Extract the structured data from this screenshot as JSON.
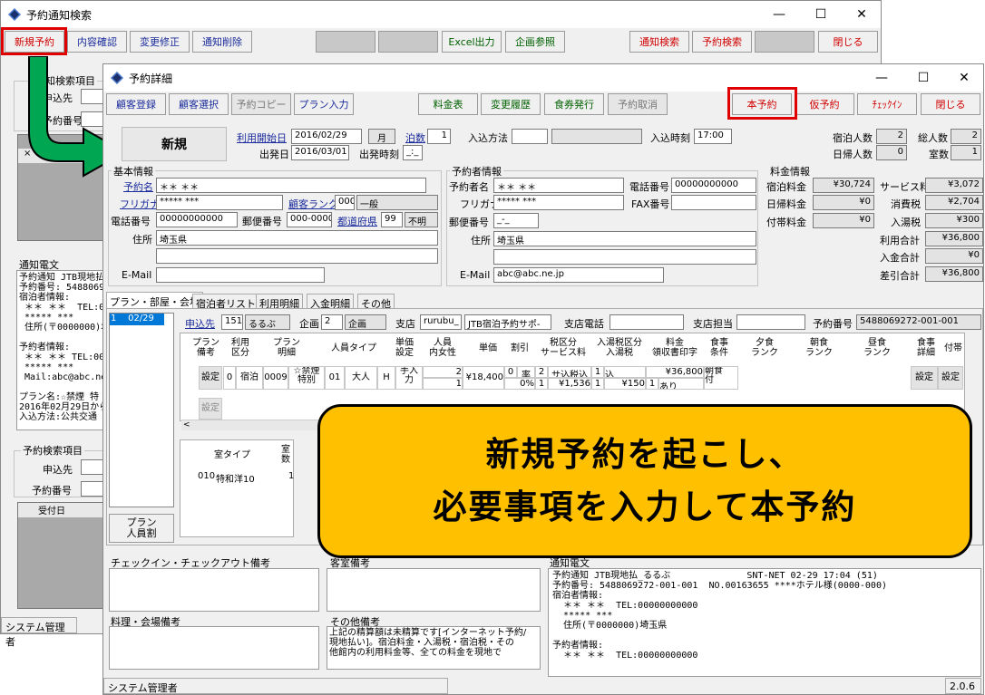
{
  "back": {
    "title": "予約通知検索",
    "toolbar": [
      "新規予約",
      "内容確認",
      "変更修正",
      "通知削除",
      "Excel出力",
      "企画参照",
      "通知検索",
      "予約検索",
      "閉じる"
    ],
    "search_group": "通知検索項目",
    "search_labels": [
      "申込先",
      "予約番号"
    ],
    "notice_title": "通知電文",
    "notice_text": "予約通知 JTB現地払\n予約番号: 5488069\n宿泊者情報:\n ＊＊ ＊＊  TEL:00\n ***** ***\n 住所(〒0000000)埼\n\n予約者情報:\n ＊＊ ＊＊ TEL:00\n ***** ***\n Mail:abc@abc.ne.jp\n\nプラン名:☆禁煙 特\n2016年02月29日から\n入込方法:公共交通",
    "rsearch_group": "予約検索項目",
    "rsearch_labels": [
      "申込先",
      "予約番号"
    ],
    "list_col": "受付日",
    "status": "システム管理者"
  },
  "front": {
    "title": "予約詳細",
    "toolbar_left": [
      "顧客登録",
      "顧客選択",
      "予約コピー",
      "プラン入力"
    ],
    "toolbar_mid": [
      "料金表",
      "変更履歴",
      "食券発行",
      "予約取消"
    ],
    "toolbar_right": [
      "本予約",
      "仮予約",
      "ﾁｪｯｸｲﾝ",
      "閉じる"
    ],
    "mode": "新規",
    "top": {
      "riyou_label": "利用開始日",
      "riyou_val": "2016/02/29",
      "youbi": "月",
      "hakusu_label": "泊数",
      "hakusu_val": "1",
      "irikomi_label": "入込方法",
      "nyukan_label": "入込時刻",
      "nyukan_val": "17:00",
      "hatsu_label": "出発日",
      "hatsu_val": "2016/03/01",
      "hatsu_time_label": "出発時刻",
      "hatsu_time_val": "_:_",
      "shuku_label": "宿泊人数",
      "shuku_val": "2",
      "sou_label": "総人数",
      "sou_val": "2",
      "higaeri_label": "日帰人数",
      "higaeri_val": "0",
      "shitsu_label": "室数",
      "shitsu_val": "1"
    },
    "kihon": {
      "title": "基本情報",
      "name_label": "予約名",
      "name_val": "＊＊ ＊＊",
      "kana_label": "フリガナ",
      "kana_val": "***** ***",
      "rank_label": "顧客ランク",
      "rank_code": "000",
      "rank_val": "一般",
      "tel_label": "電話番号",
      "tel_val": "00000000000",
      "zip_label": "郵便番号",
      "zip_val": "000-0000",
      "pref_label": "都道府県",
      "pref_code": "99",
      "pref_val": "不明",
      "addr_label": "住所",
      "addr_val": "埼玉県",
      "mail_label": "E-Mail"
    },
    "yoyaku": {
      "title": "予約者情報",
      "name_label": "予約者名",
      "name_val": "＊＊ ＊＊",
      "kana_label": "フリガナ",
      "kana_val": "***** ***",
      "tel_label": "電話番号",
      "tel_val": "00000000000",
      "fax_label": "FAX番号",
      "zip_label": "郵便番号",
      "zip_val": "_-_",
      "addr_label": "住所",
      "addr_val": "埼玉県",
      "mail_label": "E-Mail",
      "mail_val": "abc@abc.ne.jp"
    },
    "ryokin": {
      "title": "料金情報",
      "left": [
        {
          "l": "宿泊料金",
          "v": "¥30,724"
        },
        {
          "l": "日帰料金",
          "v": "¥0"
        },
        {
          "l": "付帯料金",
          "v": "¥0"
        }
      ],
      "right": [
        {
          "l": "サービス料",
          "v": "¥3,072"
        },
        {
          "l": "消費税",
          "v": "¥2,704"
        },
        {
          "l": "入湯税",
          "v": "¥300"
        },
        {
          "l": "利用合計",
          "v": "¥36,800"
        },
        {
          "l": "入金合計",
          "v": "¥0"
        },
        {
          "l": "差引合計",
          "v": "¥36,800"
        }
      ]
    },
    "tabs": [
      "プラン・部屋・会場",
      "宿泊者リスト",
      "利用明細",
      "入金明細",
      "その他"
    ],
    "plan_list_item": "1    02/29",
    "plan": {
      "mosikomi_label": "申込先",
      "mosikomi_code": "151",
      "mosikomi_val": "るるぶ",
      "kikaku_label": "企画",
      "kikaku_code": "2",
      "kikaku_val": "企画",
      "shiten_label": "支店",
      "shiten_code": "rurubu_",
      "shiten_val": "JTB宿泊予約サポ-",
      "shiten_tel_label": "支店電話",
      "shiten_tanto_label": "支店担当",
      "yoyaku_no_label": "予約番号",
      "yoyaku_no_val": "5488069272-001-001"
    },
    "grid_headers": [
      "プラン\n備考",
      "利用\n区分",
      "プラン\n明細",
      "人員タイプ",
      "単価\n設定",
      "人員\n内女性",
      "単価",
      "割引",
      "税区分\nサービス料",
      "入湯税区分\n入湯税",
      "料金\n領収書印字",
      "食事\n条件",
      "夕食\nランク",
      "朝食\nランク",
      "昼食\nランク",
      "食事\n詳細",
      "付帯"
    ],
    "grid_row": [
      "設定",
      "0",
      "宿泊",
      "0009",
      "☆禁煙\n特別",
      "01",
      "大人",
      "H",
      "手入\n力",
      "2",
      "¥18,400",
      "0",
      "率",
      "2",
      "サ込税込",
      "1",
      "込",
      "¥36,800",
      "朝食\n付",
      "設定",
      "設定"
    ],
    "grid_row2": [
      "1",
      "0%",
      "1",
      "¥1,536",
      "1",
      "¥150",
      "1",
      "あり"
    ],
    "grid_row3": "設定",
    "room_headers": [
      "室タイプ",
      "室\n数"
    ],
    "room_row": [
      "010",
      "特和洋10",
      "1"
    ],
    "plan_btn": "プラン\n人員割",
    "checkin_note": "チェックイン・チェックアウト備考",
    "kyakushitsu_note": "客室備考",
    "ryori_note": "料理・会場備考",
    "sonota_note": "その他備考",
    "sonota_text": "上記の精算額は未精算です[インターネット予約/\n現地払い]。宿泊料金・入湯税・宿泊税・その\n他館内の利用料金等、全ての料金を現地で",
    "notice_title": "通知電文",
    "notice_text": "予約通知 JTB現地払_るるぶ              SNT-NET 02-29 17:04 (51)\n予約番号: 5488069272-001-001  NO.00163655 ****ホテル様(0000-000)\n宿泊者情報:\n  ＊＊ ＊＊  TEL:00000000000\n  ***** ***\n  住所(〒0000000)埼玉県\n\n予約者情報:\n  ＊＊ ＊＊  TEL:00000000000",
    "status": "システム管理者",
    "version": "2.0.6"
  },
  "callout": {
    "line1": "新規予約を起こし、",
    "line2": "必要事項を入力して本予約"
  }
}
